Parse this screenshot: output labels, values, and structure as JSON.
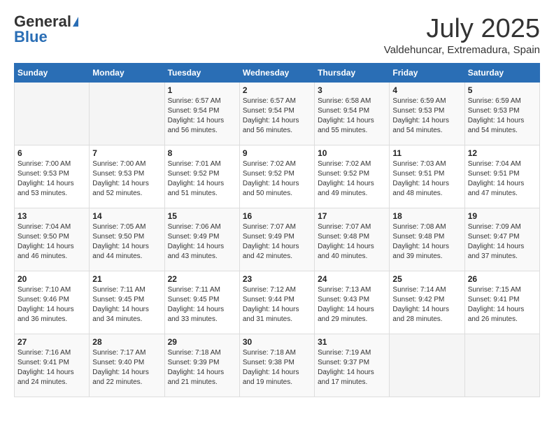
{
  "header": {
    "logo_general": "General",
    "logo_blue": "Blue",
    "month_title": "July 2025",
    "location": "Valdehuncar, Extremadura, Spain"
  },
  "calendar": {
    "days_of_week": [
      "Sunday",
      "Monday",
      "Tuesday",
      "Wednesday",
      "Thursday",
      "Friday",
      "Saturday"
    ],
    "weeks": [
      [
        {
          "day": "",
          "info": ""
        },
        {
          "day": "",
          "info": ""
        },
        {
          "day": "1",
          "info": "Sunrise: 6:57 AM\nSunset: 9:54 PM\nDaylight: 14 hours and 56 minutes."
        },
        {
          "day": "2",
          "info": "Sunrise: 6:57 AM\nSunset: 9:54 PM\nDaylight: 14 hours and 56 minutes."
        },
        {
          "day": "3",
          "info": "Sunrise: 6:58 AM\nSunset: 9:54 PM\nDaylight: 14 hours and 55 minutes."
        },
        {
          "day": "4",
          "info": "Sunrise: 6:59 AM\nSunset: 9:53 PM\nDaylight: 14 hours and 54 minutes."
        },
        {
          "day": "5",
          "info": "Sunrise: 6:59 AM\nSunset: 9:53 PM\nDaylight: 14 hours and 54 minutes."
        }
      ],
      [
        {
          "day": "6",
          "info": "Sunrise: 7:00 AM\nSunset: 9:53 PM\nDaylight: 14 hours and 53 minutes."
        },
        {
          "day": "7",
          "info": "Sunrise: 7:00 AM\nSunset: 9:53 PM\nDaylight: 14 hours and 52 minutes."
        },
        {
          "day": "8",
          "info": "Sunrise: 7:01 AM\nSunset: 9:52 PM\nDaylight: 14 hours and 51 minutes."
        },
        {
          "day": "9",
          "info": "Sunrise: 7:02 AM\nSunset: 9:52 PM\nDaylight: 14 hours and 50 minutes."
        },
        {
          "day": "10",
          "info": "Sunrise: 7:02 AM\nSunset: 9:52 PM\nDaylight: 14 hours and 49 minutes."
        },
        {
          "day": "11",
          "info": "Sunrise: 7:03 AM\nSunset: 9:51 PM\nDaylight: 14 hours and 48 minutes."
        },
        {
          "day": "12",
          "info": "Sunrise: 7:04 AM\nSunset: 9:51 PM\nDaylight: 14 hours and 47 minutes."
        }
      ],
      [
        {
          "day": "13",
          "info": "Sunrise: 7:04 AM\nSunset: 9:50 PM\nDaylight: 14 hours and 46 minutes."
        },
        {
          "day": "14",
          "info": "Sunrise: 7:05 AM\nSunset: 9:50 PM\nDaylight: 14 hours and 44 minutes."
        },
        {
          "day": "15",
          "info": "Sunrise: 7:06 AM\nSunset: 9:49 PM\nDaylight: 14 hours and 43 minutes."
        },
        {
          "day": "16",
          "info": "Sunrise: 7:07 AM\nSunset: 9:49 PM\nDaylight: 14 hours and 42 minutes."
        },
        {
          "day": "17",
          "info": "Sunrise: 7:07 AM\nSunset: 9:48 PM\nDaylight: 14 hours and 40 minutes."
        },
        {
          "day": "18",
          "info": "Sunrise: 7:08 AM\nSunset: 9:48 PM\nDaylight: 14 hours and 39 minutes."
        },
        {
          "day": "19",
          "info": "Sunrise: 7:09 AM\nSunset: 9:47 PM\nDaylight: 14 hours and 37 minutes."
        }
      ],
      [
        {
          "day": "20",
          "info": "Sunrise: 7:10 AM\nSunset: 9:46 PM\nDaylight: 14 hours and 36 minutes."
        },
        {
          "day": "21",
          "info": "Sunrise: 7:11 AM\nSunset: 9:45 PM\nDaylight: 14 hours and 34 minutes."
        },
        {
          "day": "22",
          "info": "Sunrise: 7:11 AM\nSunset: 9:45 PM\nDaylight: 14 hours and 33 minutes."
        },
        {
          "day": "23",
          "info": "Sunrise: 7:12 AM\nSunset: 9:44 PM\nDaylight: 14 hours and 31 minutes."
        },
        {
          "day": "24",
          "info": "Sunrise: 7:13 AM\nSunset: 9:43 PM\nDaylight: 14 hours and 29 minutes."
        },
        {
          "day": "25",
          "info": "Sunrise: 7:14 AM\nSunset: 9:42 PM\nDaylight: 14 hours and 28 minutes."
        },
        {
          "day": "26",
          "info": "Sunrise: 7:15 AM\nSunset: 9:41 PM\nDaylight: 14 hours and 26 minutes."
        }
      ],
      [
        {
          "day": "27",
          "info": "Sunrise: 7:16 AM\nSunset: 9:41 PM\nDaylight: 14 hours and 24 minutes."
        },
        {
          "day": "28",
          "info": "Sunrise: 7:17 AM\nSunset: 9:40 PM\nDaylight: 14 hours and 22 minutes."
        },
        {
          "day": "29",
          "info": "Sunrise: 7:18 AM\nSunset: 9:39 PM\nDaylight: 14 hours and 21 minutes."
        },
        {
          "day": "30",
          "info": "Sunrise: 7:18 AM\nSunset: 9:38 PM\nDaylight: 14 hours and 19 minutes."
        },
        {
          "day": "31",
          "info": "Sunrise: 7:19 AM\nSunset: 9:37 PM\nDaylight: 14 hours and 17 minutes."
        },
        {
          "day": "",
          "info": ""
        },
        {
          "day": "",
          "info": ""
        }
      ]
    ]
  }
}
